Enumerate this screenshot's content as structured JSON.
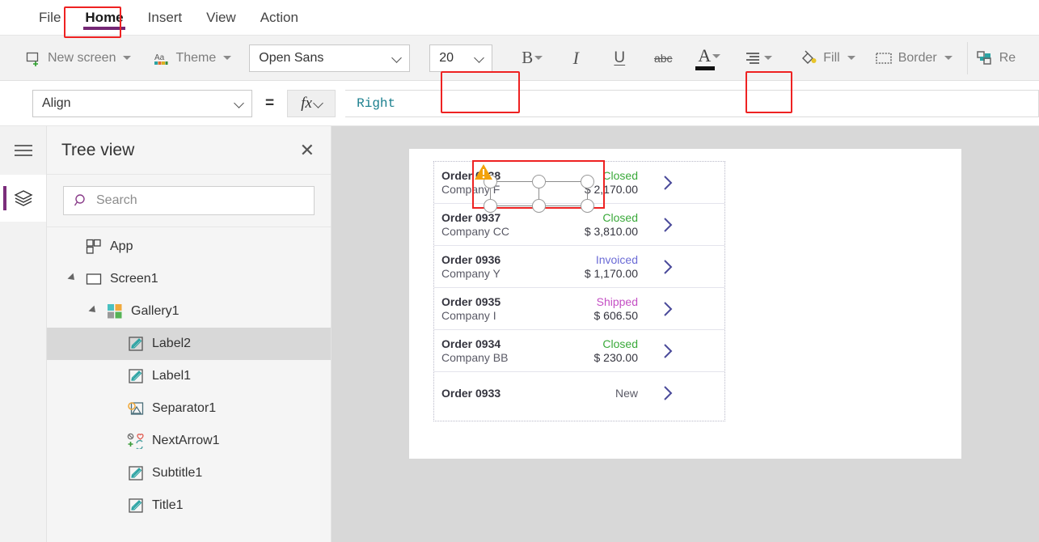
{
  "menubar": {
    "items": [
      {
        "label": "File",
        "active": false
      },
      {
        "label": "Home",
        "active": true
      },
      {
        "label": "Insert",
        "active": false
      },
      {
        "label": "View",
        "active": false
      },
      {
        "label": "Action",
        "active": false
      }
    ]
  },
  "ribbon": {
    "new_screen_label": "New screen",
    "theme_label": "Theme",
    "font_family_value": "Open Sans",
    "font_size_value": "20",
    "bold_label": "B",
    "italic_label": "I",
    "underline_label": "U",
    "strikethrough_label": "abc",
    "font_color_label": "A",
    "fill_label": "Fill",
    "border_label": "Border",
    "reorder_label": "Re"
  },
  "formula_bar": {
    "property_value": "Align",
    "equals": "=",
    "fx_label": "fx",
    "formula_value": "Right"
  },
  "tree_view": {
    "title": "Tree view",
    "search_placeholder": "Search",
    "items": [
      {
        "label": "App",
        "indent": 0,
        "icon": "app-icon",
        "expandable": false,
        "selected": false
      },
      {
        "label": "Screen1",
        "indent": 0,
        "icon": "screen-icon",
        "expandable": true,
        "selected": false
      },
      {
        "label": "Gallery1",
        "indent": 1,
        "icon": "gallery-icon",
        "expandable": true,
        "selected": false
      },
      {
        "label": "Label2",
        "indent": 2,
        "icon": "label-icon",
        "expandable": false,
        "selected": true
      },
      {
        "label": "Label1",
        "indent": 2,
        "icon": "label-icon",
        "expandable": false,
        "selected": false
      },
      {
        "label": "Separator1",
        "indent": 2,
        "icon": "image-icon",
        "expandable": false,
        "selected": false
      },
      {
        "label": "NextArrow1",
        "indent": 2,
        "icon": "icon-group-icon",
        "expandable": false,
        "selected": false
      },
      {
        "label": "Subtitle1",
        "indent": 2,
        "icon": "label-icon",
        "expandable": false,
        "selected": false
      },
      {
        "label": "Title1",
        "indent": 2,
        "icon": "label-icon",
        "expandable": false,
        "selected": false
      }
    ]
  },
  "canvas": {
    "gallery_rows": [
      {
        "title": "Order 0938",
        "subtitle": "Company F",
        "status": "Closed",
        "status_color": "#3aa93a",
        "amount": "$ 2,170.00",
        "selected": true
      },
      {
        "title": "Order 0937",
        "subtitle": "Company CC",
        "status": "Closed",
        "status_color": "#3aa93a",
        "amount": "$ 3,810.00",
        "selected": false
      },
      {
        "title": "Order 0936",
        "subtitle": "Company Y",
        "status": "Invoiced",
        "status_color": "#6b6bd6",
        "amount": "$ 1,170.00",
        "selected": false
      },
      {
        "title": "Order 0935",
        "subtitle": "Company I",
        "status": "Shipped",
        "status_color": "#c44fc4",
        "amount": "$ 606.50",
        "selected": false
      },
      {
        "title": "Order 0934",
        "subtitle": "Company BB",
        "status": "Closed",
        "status_color": "#3aa93a",
        "amount": "$ 230.00",
        "selected": false
      },
      {
        "title": "Order 0933",
        "subtitle": "",
        "status": "New",
        "status_color": "#5a5a66",
        "amount": "",
        "selected": false
      }
    ]
  },
  "colors": {
    "accent_purple": "#742774",
    "highlight_red": "#ee2222",
    "formula_teal": "#1a7f8e",
    "canvas_gray": "#d8d8d8",
    "warning_amber": "#f2a20c"
  }
}
